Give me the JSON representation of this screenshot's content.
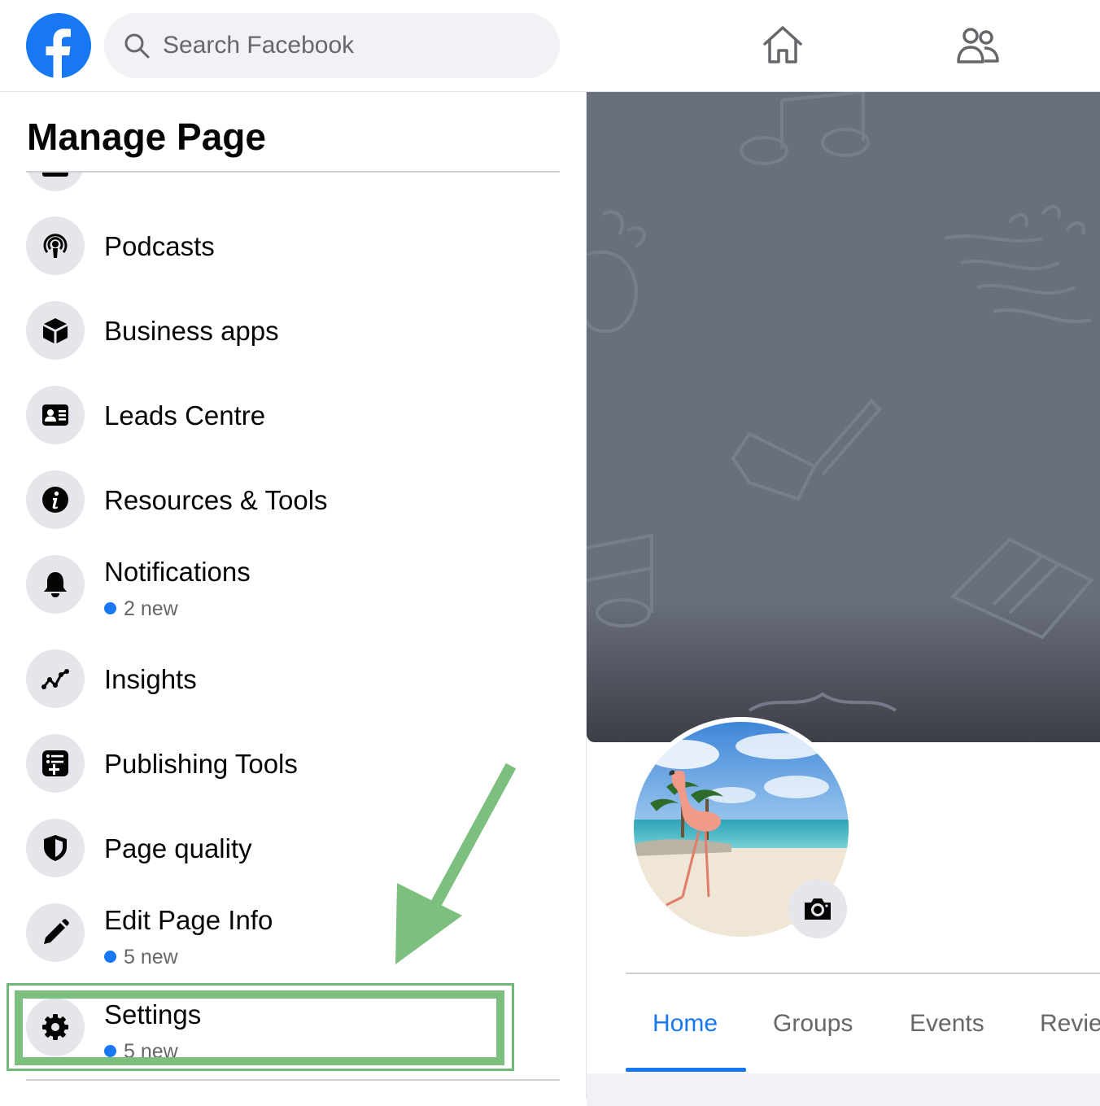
{
  "search": {
    "placeholder": "Search Facebook"
  },
  "sidebar": {
    "title": "Manage Page",
    "items": [
      {
        "label": "Podcasts",
        "icon": "podcast-icon"
      },
      {
        "label": "Business apps",
        "icon": "cube-icon"
      },
      {
        "label": "Leads Centre",
        "icon": "contact-card-icon"
      },
      {
        "label": "Resources & Tools",
        "icon": "info-icon"
      },
      {
        "label": "Notifications",
        "icon": "bell-icon",
        "badge": "2 new"
      },
      {
        "label": "Insights",
        "icon": "trend-icon"
      },
      {
        "label": "Publishing Tools",
        "icon": "publishing-icon"
      },
      {
        "label": "Page quality",
        "icon": "shield-icon"
      },
      {
        "label": "Edit Page Info",
        "icon": "pencil-icon",
        "badge": "5 new"
      },
      {
        "label": "Settings",
        "icon": "gear-icon",
        "badge": "5 new"
      }
    ]
  },
  "page_tabs": [
    "Home",
    "Groups",
    "Events",
    "Revie"
  ],
  "active_tab": "Home",
  "colors": {
    "accent": "#1877f2",
    "highlight": "#7dbf7f",
    "cover": "#6a6f7e"
  }
}
